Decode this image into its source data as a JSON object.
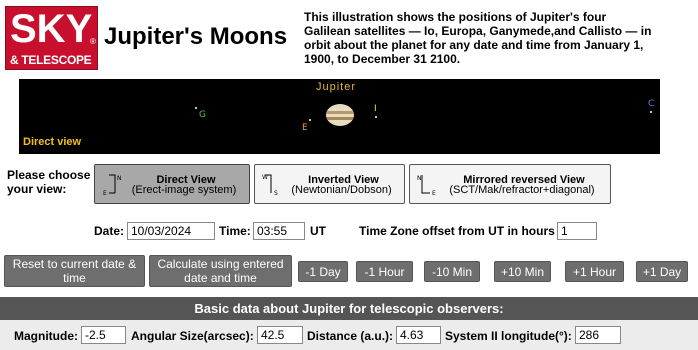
{
  "logo": {
    "line1": "SKY",
    "reg": "®",
    "line2": "& TELESCOPE"
  },
  "title": "Jupiter's Moons",
  "intro": "This illustration shows the positions of Jupiter's four Galilean satellites — Io, Europa, Ganymede,and Callisto — in orbit about the planet for any date and time from January 1, 1900, to December 31 2100.",
  "sky": {
    "planet_label": "Jupiter",
    "view_label": "Direct view",
    "moons": [
      {
        "letter": "G",
        "color": "#50c850"
      },
      {
        "letter": "E",
        "color": "#f0a030"
      },
      {
        "letter": "I",
        "color": "#f0e040"
      },
      {
        "letter": "C",
        "color": "#6080ff"
      }
    ]
  },
  "views": {
    "prompt": "Please choose your view:",
    "options": [
      {
        "title": "Direct View",
        "subtitle": "(Erect-image system)",
        "active": true
      },
      {
        "title": "Inverted View",
        "subtitle": "(Newtonian/Dobson)",
        "active": false
      },
      {
        "title": "Mirrored reversed View",
        "subtitle": "(SCT/Mak/refractor+diagonal)",
        "active": false
      }
    ]
  },
  "datetime": {
    "date_label": "Date:",
    "date_value": "10/03/2024",
    "time_label": "Time:",
    "time_value": "03:55",
    "ut_label": "UT",
    "tz_label": "Time Zone offset from UT in hours",
    "tz_value": "1"
  },
  "actions": {
    "reset": "Reset to current date & time",
    "calculate": "Calculate using entered date and time",
    "steps": [
      "-1 Day",
      "-1 Hour",
      "-10 Min",
      "+10 Min",
      "+1 Hour",
      "+1 Day"
    ]
  },
  "basic": {
    "header": "Basic data about Jupiter for telescopic observers:",
    "magnitude_label": "Magnitude:",
    "magnitude_value": "-2.5",
    "size_label": "Angular Size(arcsec):",
    "size_value": "42.5",
    "distance_label": "Distance (a.u.):",
    "distance_value": "4.63",
    "longitude_label": "System II longitude(°):",
    "longitude_value": "286"
  }
}
